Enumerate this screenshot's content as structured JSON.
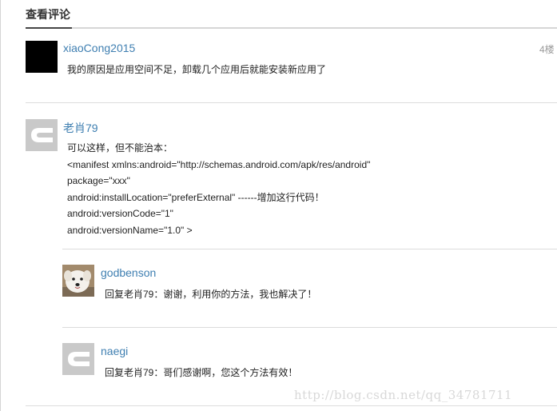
{
  "header": {
    "title": "查看评论"
  },
  "comments": [
    {
      "user": "xiaoCong2015",
      "floor": "4楼",
      "lines": [
        "我的原因是应用空间不足，卸载几个应用后就能安装新应用了"
      ],
      "avatar": "black-square-avatar"
    },
    {
      "user": "老肖79",
      "lines": [
        "可以这样，但不能治本：",
        "<manifest xmlns:android=\"http://schemas.android.com/apk/res/android\"",
        "package=\"xxx\"",
        "android:installLocation=\"preferExternal\" ------增加这行代码！",
        "android:versionCode=\"1\"",
        "android:versionName=\"1.0\" >"
      ],
      "avatar": "c-logo-avatar",
      "replies": [
        {
          "user": "godbenson",
          "text": "回复老肖79：谢谢，利用你的方法，我也解决了！",
          "avatar": "white-dog-photo-avatar"
        },
        {
          "user": "naegi",
          "text": "回复老肖79：哥们感谢啊，您这个方法有效！",
          "avatar": "c-logo-avatar"
        }
      ]
    }
  ],
  "watermark": "http://blog.csdn.net/qq_34781711",
  "colors": {
    "username": "#3f7fb1",
    "separator": "#dcdcdc",
    "avatar_c_bg": "#c9c9c9"
  }
}
